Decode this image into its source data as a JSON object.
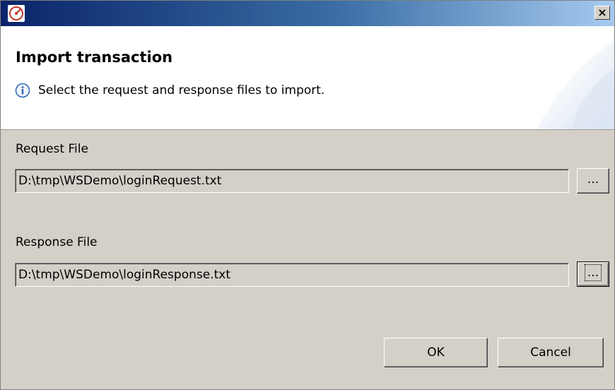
{
  "window": {
    "app_icon": "gauge-icon",
    "close_label": "×",
    "title_gradient": [
      "#0a246a",
      "#3a6ea5",
      "#a6caf0"
    ]
  },
  "banner": {
    "title": "Import transaction",
    "info_icon": "info-icon",
    "message": "Select the request and response files to import."
  },
  "request": {
    "label": "Request File",
    "value": "D:\\tmp\\WSDemo\\loginRequest.txt",
    "browse_label": "..."
  },
  "response": {
    "label": "Response File",
    "value": "D:\\tmp\\WSDemo\\loginResponse.txt",
    "browse_label": "..."
  },
  "buttons": {
    "ok_label": "OK",
    "cancel_label": "Cancel"
  }
}
